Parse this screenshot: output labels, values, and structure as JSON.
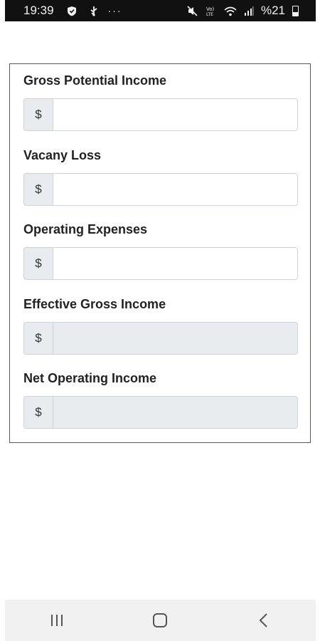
{
  "status_bar": {
    "time": "19:39",
    "battery_text": "%21",
    "icons": [
      "shield-icon",
      "usb-icon",
      "more-dots-icon",
      "mute-icon",
      "volte-icon",
      "wifi-icon",
      "signal-icon",
      "battery-icon"
    ]
  },
  "form": {
    "fields": [
      {
        "label": "Gross Potential Income",
        "prefix": "$",
        "value": "",
        "editable": true
      },
      {
        "label": "Vacany Loss",
        "prefix": "$",
        "value": "",
        "editable": true
      },
      {
        "label": "Operating Expenses",
        "prefix": "$",
        "value": "",
        "editable": true
      },
      {
        "label": "Effective Gross Income",
        "prefix": "$",
        "value": "",
        "editable": false
      },
      {
        "label": "Net Operating Income",
        "prefix": "$",
        "value": "",
        "editable": false
      }
    ]
  },
  "nav_bar": {
    "buttons": [
      "recent-apps-icon",
      "home-icon",
      "back-icon"
    ]
  },
  "colors": {
    "status_bar_bg": "#111111",
    "readonly_bg": "#e9ecef",
    "nav_bar_bg": "#f1f1f1"
  }
}
